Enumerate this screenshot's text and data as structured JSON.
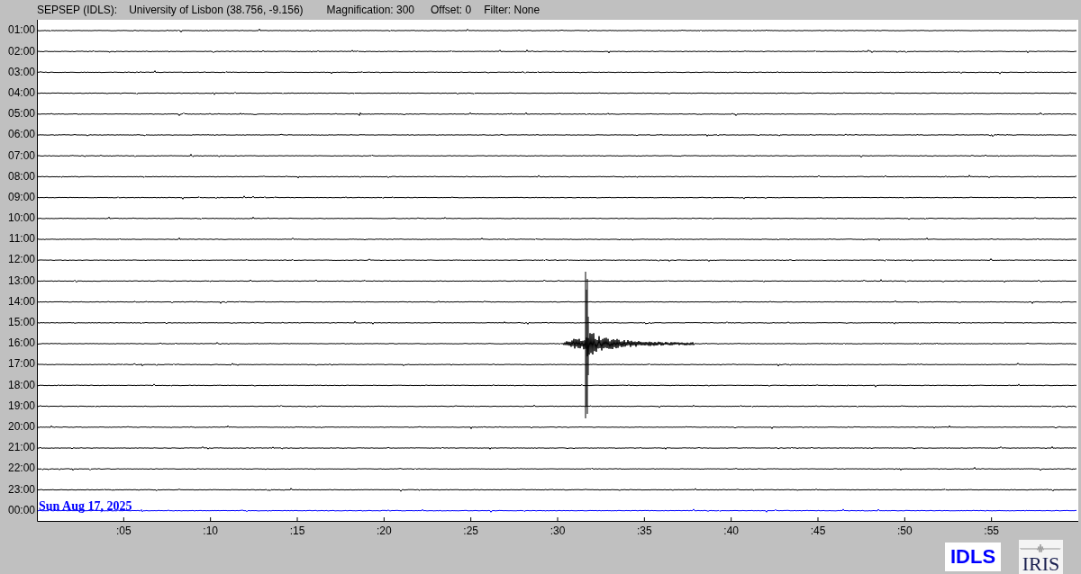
{
  "header": {
    "station": "SEPSEP (IDLS):",
    "location": "University of Lisbon (38.756, -9.156)",
    "magnification": "Magnification: 300",
    "offset": "Offset: 0",
    "filter": "Filter: None"
  },
  "rows": [
    {
      "label": "01:00",
      "color": "#000000"
    },
    {
      "label": "02:00",
      "color": "#000000"
    },
    {
      "label": "03:00",
      "color": "#000000"
    },
    {
      "label": "04:00",
      "color": "#000000"
    },
    {
      "label": "05:00",
      "color": "#000000"
    },
    {
      "label": "06:00",
      "color": "#000000"
    },
    {
      "label": "07:00",
      "color": "#000000"
    },
    {
      "label": "08:00",
      "color": "#000000"
    },
    {
      "label": "09:00",
      "color": "#000000"
    },
    {
      "label": "10:00",
      "color": "#000000"
    },
    {
      "label": "11:00",
      "color": "#000000"
    },
    {
      "label": "12:00",
      "color": "#000000"
    },
    {
      "label": "13:00",
      "color": "#000000"
    },
    {
      "label": "14:00",
      "color": "#000000"
    },
    {
      "label": "15:00",
      "color": "#000000"
    },
    {
      "label": "16:00",
      "color": "#000000"
    },
    {
      "label": "17:00",
      "color": "#000000"
    },
    {
      "label": "18:00",
      "color": "#000000"
    },
    {
      "label": "19:00",
      "color": "#000000"
    },
    {
      "label": "20:00",
      "color": "#000000"
    },
    {
      "label": "21:00",
      "color": "#000000"
    },
    {
      "label": "22:00",
      "color": "#000000"
    },
    {
      "label": "23:00",
      "color": "#000000"
    },
    {
      "label": "00:00",
      "color": "#0000ff"
    }
  ],
  "date_label": "Sun Aug 17, 2025",
  "x_ticks": [
    ":05",
    ":10",
    ":15",
    ":20",
    ":25",
    ":30",
    ":35",
    ":40",
    ":45",
    ":50",
    ":55"
  ],
  "logos": {
    "station": "IDLS",
    "network": "IRIS"
  }
}
